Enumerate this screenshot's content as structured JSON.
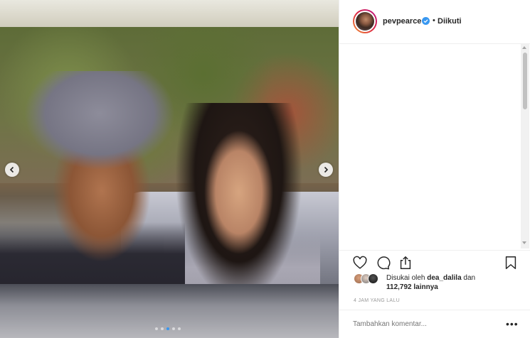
{
  "post": {
    "username": "pevpearce",
    "separator": "•",
    "follow_status": "Diikuti",
    "liked_by_prefix": "Disukai oleh",
    "liked_by_user": "dea_dalila",
    "liked_by_and": "dan",
    "likes_count_text": "112,792 lainnya",
    "time_text": "4 JAM YANG LALU",
    "comment_placeholder": "Tambahkan komentar...",
    "more_label": "•••"
  },
  "carousel": {
    "total": 5,
    "active_index": 2
  },
  "icons": {
    "like": "heart-icon",
    "comment": "comment-icon",
    "share": "share-icon",
    "save": "bookmark-icon",
    "verified": "verified-badge-icon",
    "prev": "chevron-left-icon",
    "next": "chevron-right-icon"
  },
  "colors": {
    "accent": "#3897f0",
    "text": "#262626",
    "muted": "#999999"
  }
}
